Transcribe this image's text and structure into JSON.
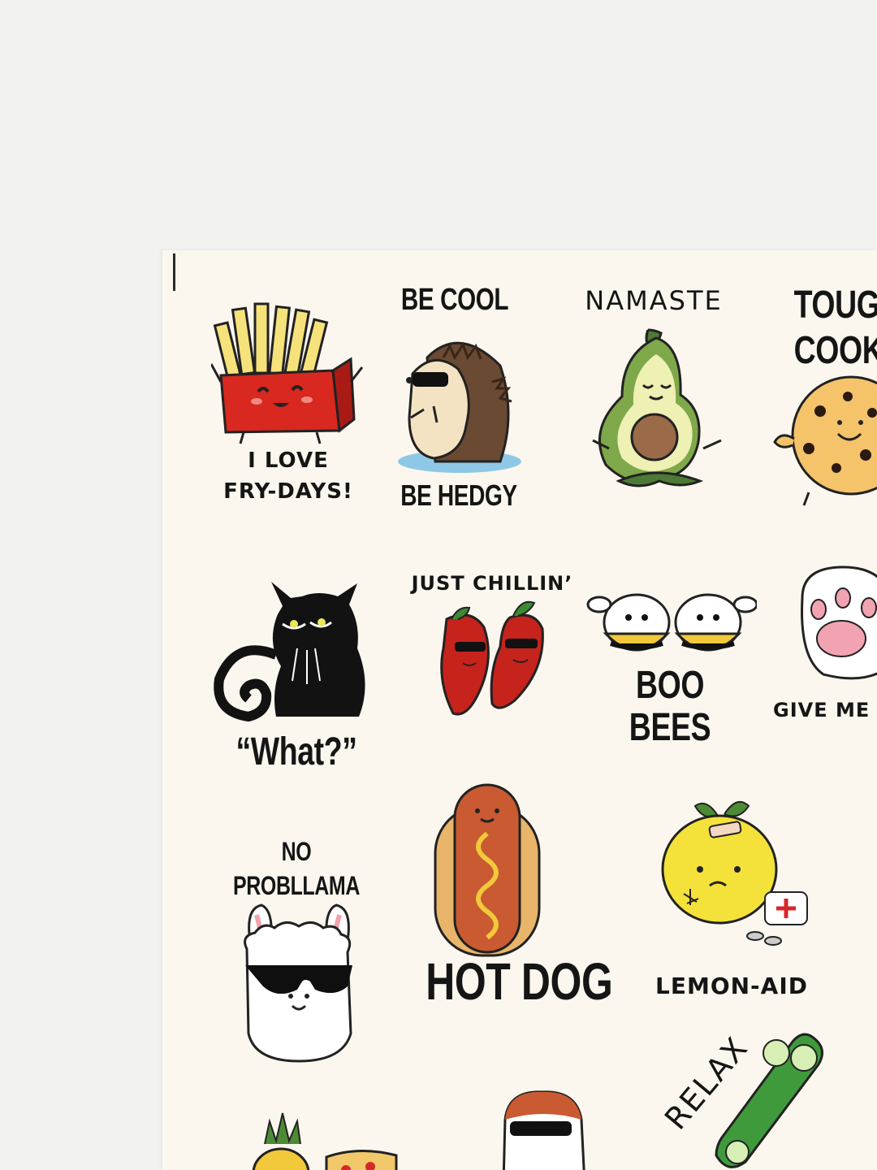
{
  "stickers": {
    "fries": {
      "line1": "I LOVE",
      "line2": "FRY-DAYS!"
    },
    "hedgehog": {
      "top": "BE COOL",
      "bottom": "BE HEDGY"
    },
    "avocado": {
      "top": "NAMASTE"
    },
    "cookie": {
      "line1": "TOUGH",
      "line2": "COOKIE"
    },
    "cat": {
      "caption": "“What?”"
    },
    "peppers": {
      "top": "JUST CHILLIN’"
    },
    "bees": {
      "line1": "BOO",
      "line2": "BEES"
    },
    "paw": {
      "caption": "GIVE ME"
    },
    "llama": {
      "line1": "NO",
      "line2": "PROBLLAMA"
    },
    "hotdog": {
      "caption": "HOT DOG"
    },
    "lemon": {
      "caption": "LEMON-AID"
    },
    "cucumber": {
      "caption": "RELAX"
    }
  },
  "colors": {
    "sheet": "#fbf7ee",
    "ink": "#151515",
    "fries_red": "#d8281f",
    "fries_yellow": "#f6e27a",
    "avocado_green": "#7fa84a",
    "pepper_red": "#c5231c",
    "lemon_yellow": "#f4e23a",
    "cucumber_green": "#3f9a3c"
  }
}
